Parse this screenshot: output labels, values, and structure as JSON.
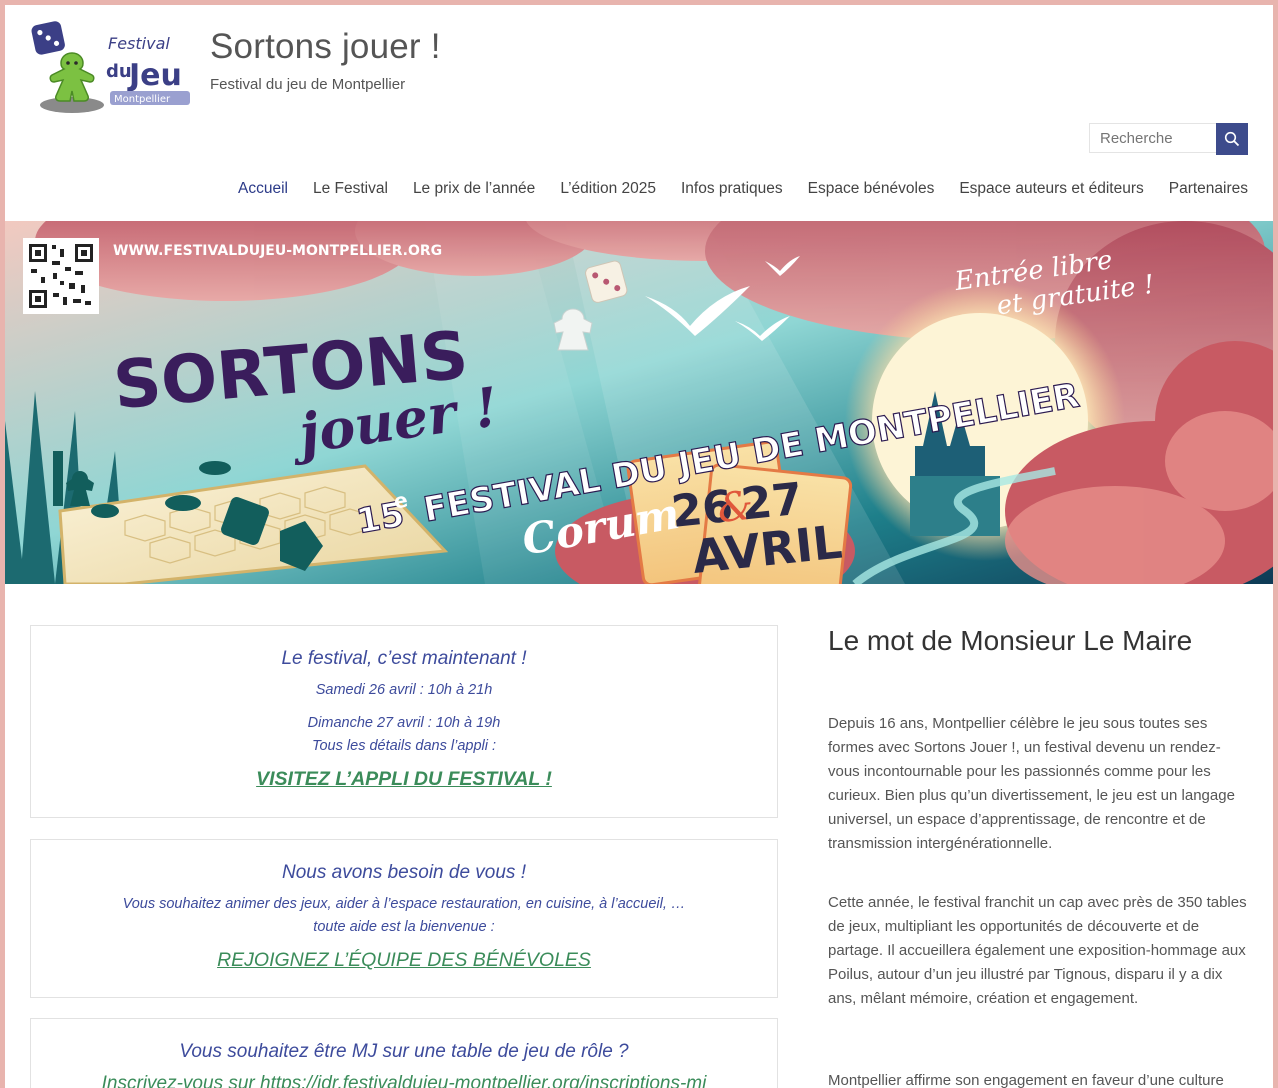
{
  "site": {
    "title": "Sortons jouer !",
    "tagline": "Festival du jeu de Montpellier",
    "logo_text": [
      "Festival",
      "du",
      "Jeu",
      "Montpellier"
    ]
  },
  "search": {
    "placeholder": "Recherche",
    "icon": "search-icon"
  },
  "nav": [
    {
      "label": "Accueil",
      "active": true
    },
    {
      "label": "Le Festival"
    },
    {
      "label": "Le prix de l’année"
    },
    {
      "label": "L’édition 2025"
    },
    {
      "label": "Infos pratiques"
    },
    {
      "label": "Espace bénévoles"
    },
    {
      "label": "Espace auteurs et éditeurs"
    },
    {
      "label": "Partenaires"
    }
  ],
  "banner": {
    "url": "WWW.FESTIVALDUJEU-MONTPELLIER.ORG",
    "title1": "SORTONS",
    "title2": "jouer !",
    "subtitle": "FESTIVAL DU JEU DE MONTPELLIER",
    "edition": "15",
    "edition_sup": "e",
    "venue": "Corum",
    "free": [
      "Entrée libre",
      "et gratuite !"
    ],
    "date_day1": "26",
    "date_amp": "&",
    "date_day2": "27",
    "date_month": "AVRIL"
  },
  "box1": {
    "heading": "Le festival, c’est maintenant !",
    "line1": "Samedi 26 avril : 10h à 21h",
    "line2": "Dimanche 27 avril : 10h à 19h",
    "line3": "Tous les détails dans l’appli :",
    "link": "VISITEZ L’APPLI DU FESTIVAL !"
  },
  "box2": {
    "heading": "Nous avons besoin de vous !",
    "line1": "Vous souhaitez animer des jeux, aider à l’espace restauration, en cuisine, à l’accueil, …",
    "line2": "toute aide est la bienvenue :",
    "link": "REJOIGNEZ L’ÉQUIPE DES BÉNÉVOLES"
  },
  "box3": {
    "heading": "Vous souhaitez être MJ sur une table de jeu de rôle ?",
    "line1": "Inscrivez-vous sur https://jdr.festivaldujeu-montpellier.org/inscriptions-mj"
  },
  "sidebar": {
    "title": "Le mot de Monsieur Le Maire",
    "p1": "Depuis 16 ans, Montpellier célèbre le jeu sous toutes ses formes avec Sortons Jouer !, un festival devenu un rendez-vous incontournable pour les passionnés comme pour les curieux. Bien plus qu’un divertissement, le jeu est un langage universel, un espace d’apprentissage, de rencontre et de transmission intergénérationnelle.",
    "p2": "Cette année, le festival franchit un cap avec près de 350 tables de jeux, multipliant les opportunités de découverte et de partage. Il accueillera également une exposition-hommage aux Poilus, autour d’un jeu illustré par Tignous, disparu il y a dix ans, mêlant mémoire, création et engagement.",
    "p3": "Montpellier affirme son engagement en faveur d’une culture"
  },
  "colors": {
    "accent": "#3d4b8c",
    "link_green": "#3b8c5a",
    "text_blue": "#3d4b9c",
    "frame": "#e8b4ae"
  }
}
